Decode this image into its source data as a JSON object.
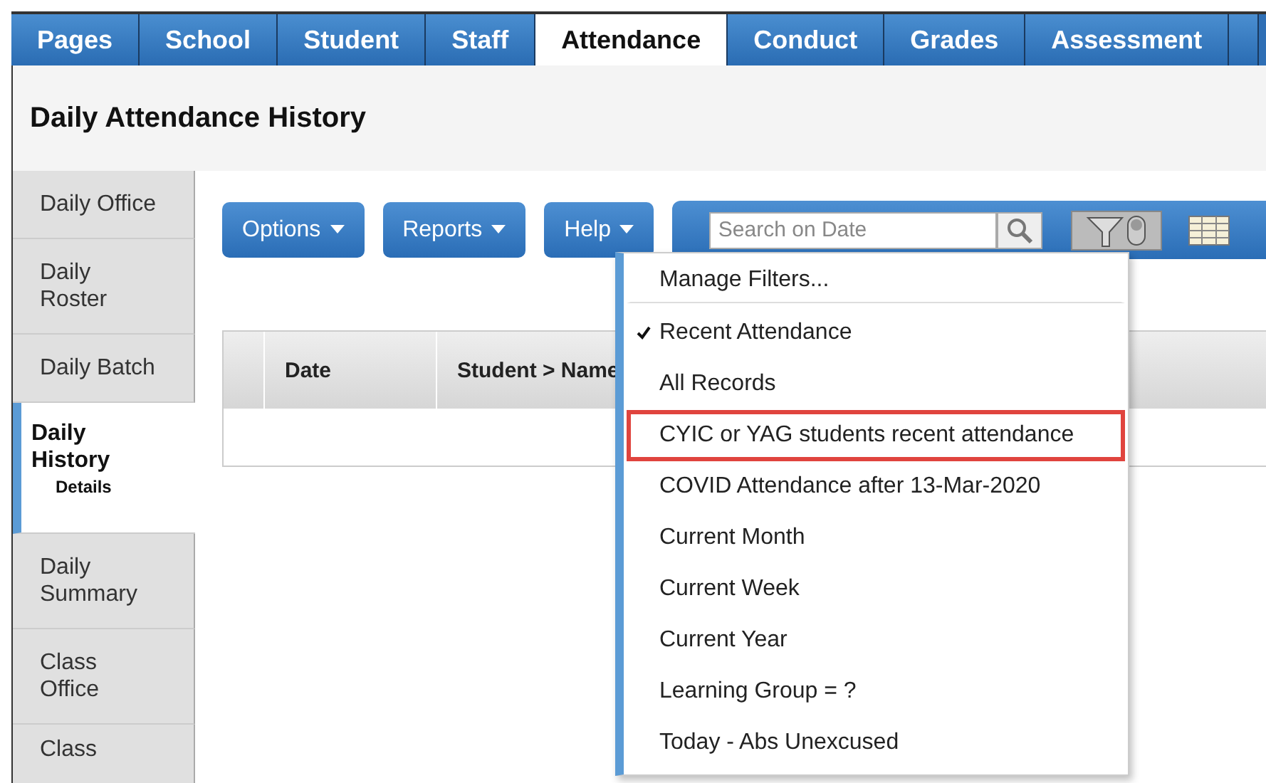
{
  "tabs": [
    {
      "label": "Pages",
      "selected": false
    },
    {
      "label": "School",
      "selected": false
    },
    {
      "label": "Student",
      "selected": false
    },
    {
      "label": "Staff",
      "selected": false
    },
    {
      "label": "Attendance",
      "selected": true
    },
    {
      "label": "Conduct",
      "selected": false
    },
    {
      "label": "Grades",
      "selected": false
    },
    {
      "label": "Assessment",
      "selected": false
    }
  ],
  "page_title": "Daily Attendance History",
  "sidebar": {
    "items": [
      {
        "label": "Daily Office",
        "selected": false
      },
      {
        "label": "Daily\nRoster",
        "selected": false
      },
      {
        "label": "Daily Batch",
        "selected": false
      },
      {
        "label": "Daily\nHistory",
        "selected": true,
        "sub": "Details"
      },
      {
        "label": "Daily\nSummary",
        "selected": false
      },
      {
        "label": "Class\nOffice",
        "selected": false
      },
      {
        "label": "Class",
        "selected": false
      }
    ]
  },
  "toolbar": {
    "buttons": [
      "Options",
      "Reports",
      "Help"
    ],
    "search": {
      "placeholder": "Search on Date"
    }
  },
  "table": {
    "columns": [
      "Date",
      "Student > Name"
    ]
  },
  "filter_menu": {
    "items": [
      {
        "label": "Manage Filters...",
        "kind": "action",
        "checked": false,
        "highlighted": false
      },
      {
        "label": "Recent Attendance",
        "kind": "filter",
        "checked": true,
        "highlighted": false
      },
      {
        "label": "All Records",
        "kind": "filter",
        "checked": false,
        "highlighted": false
      },
      {
        "label": "CYIC or YAG students recent attendance",
        "kind": "filter",
        "checked": false,
        "highlighted": true
      },
      {
        "label": "COVID Attendance after 13-Mar-2020",
        "kind": "filter",
        "checked": false,
        "highlighted": false
      },
      {
        "label": "Current Month",
        "kind": "filter",
        "checked": false,
        "highlighted": false
      },
      {
        "label": "Current Week",
        "kind": "filter",
        "checked": false,
        "highlighted": false
      },
      {
        "label": "Current Year",
        "kind": "filter",
        "checked": false,
        "highlighted": false
      },
      {
        "label": "Learning Group = ?",
        "kind": "filter",
        "checked": false,
        "highlighted": false
      },
      {
        "label": "Today - Abs Unexcused",
        "kind": "filter",
        "checked": false,
        "highlighted": false
      }
    ]
  }
}
